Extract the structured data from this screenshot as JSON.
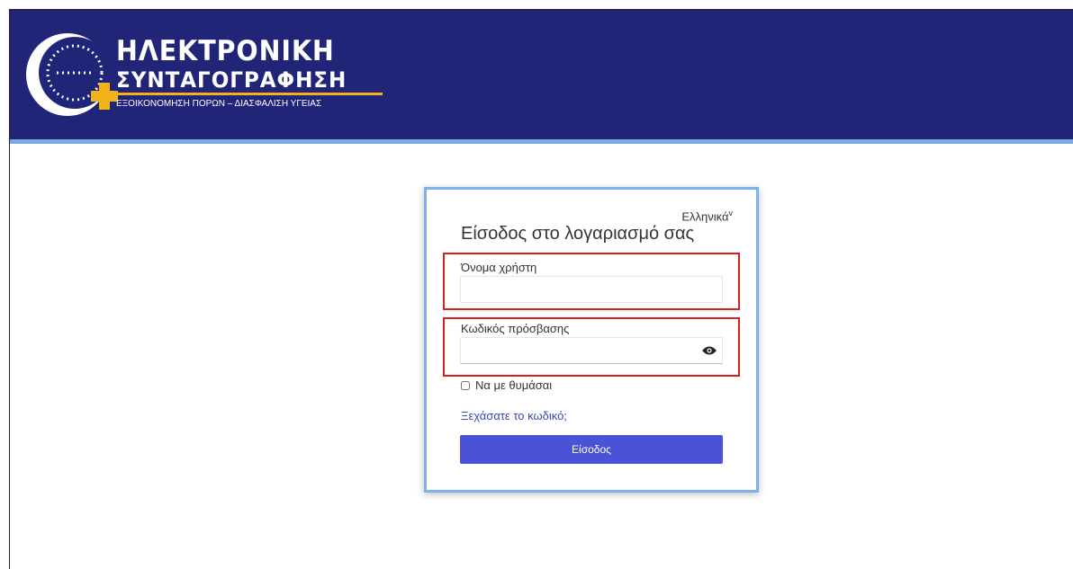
{
  "header": {
    "logo_title_line1": "ΗΛΕΚΤΡΟΝΙΚΗ",
    "logo_title_line2": "ΣΥΝΤΑΓΟΓΡΑΦΗΣΗ",
    "logo_subtitle": "ΕΞΟΙΚΟΝΟΜΗΣΗ ΠΟΡΩΝ – ΔΙΑΣΦΑΛΙΣΗ ΥΓΕΙΑΣ",
    "colors": {
      "background": "#212577",
      "accent_line": "#7aaae6",
      "logo_cross": "#f2b21b"
    }
  },
  "login": {
    "language": "Ελληνικά",
    "title": "Είσοδος στο λογαριασμό σας",
    "username_label": "Όνομα χρήστη",
    "username_value": "",
    "password_label": "Κωδικός πρόσβασης",
    "password_value": "",
    "show_password_icon": "eye-icon",
    "remember_label": "Να με θυμάσαι",
    "remember_checked": false,
    "forgot_link": "Ξεχάσατε το κωδικό;",
    "submit_label": "Είσοδος",
    "colors": {
      "card_border": "#7cb0ee",
      "button": "#4a52d6",
      "link": "#3b45b3",
      "highlight": "#d62020"
    }
  }
}
